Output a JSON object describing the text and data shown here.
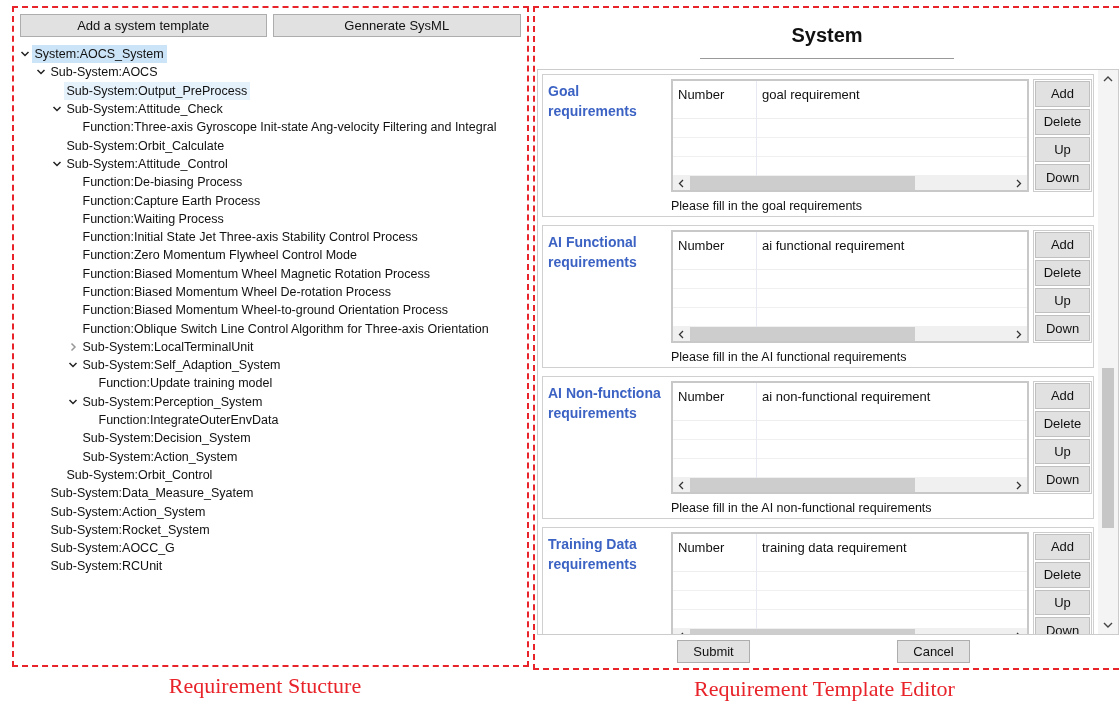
{
  "structure_panel": {
    "buttons": [
      "Add a system template",
      "Gennerate SysML"
    ],
    "tree": [
      {
        "label": "System:AOCS_System",
        "selected": true,
        "expanded": true,
        "children": [
          {
            "label": "Sub-System:AOCS",
            "selected": false,
            "expanded": true,
            "children": [
              {
                "label": "Sub-System:Output_PreProcess",
                "selected": true
              },
              {
                "label": "Sub-System:Attitude_Check",
                "selected": false,
                "expanded": true,
                "children": [
                  {
                    "label": "Function:Three-axis Gyroscope Init-state Ang-velocity Filtering and Integral",
                    "selected": false
                  }
                ]
              },
              {
                "label": "Sub-System:Orbit_Calculate",
                "selected": false
              },
              {
                "label": "Sub-System:Attitude_Control",
                "selected": false,
                "expanded": true,
                "children": [
                  {
                    "label": "Function:De-biasing Process",
                    "selected": false
                  },
                  {
                    "label": "Function:Capture Earth Process",
                    "selected": false
                  },
                  {
                    "label": "Function:Waiting Process",
                    "selected": false
                  },
                  {
                    "label": "Function:Initial State Jet Three-axis Stability Control Process",
                    "selected": false
                  },
                  {
                    "label": "Function:Zero Momentum Flywheel Control Mode",
                    "selected": false
                  },
                  {
                    "label": "Function:Biased Momentum Wheel Magnetic Rotation Process",
                    "selected": false
                  },
                  {
                    "label": "Function:Biased Momentum Wheel De-rotation Process",
                    "selected": false
                  },
                  {
                    "label": "Function:Biased Momentum Wheel-to-ground Orientation Process",
                    "selected": false
                  },
                  {
                    "label": "Function:Oblique Switch Line Control Algorithm for Three-axis Orientation",
                    "selected": false
                  },
                  {
                    "label": "Sub-System:LocalTerminalUnit",
                    "selected": false,
                    "expanded": false
                  },
                  {
                    "label": "Sub-System:Self_Adaption_System",
                    "selected": false,
                    "expanded": true,
                    "children": [
                      {
                        "label": "Function:Update training model",
                        "selected": false
                      }
                    ]
                  },
                  {
                    "label": "Sub-System:Perception_System",
                    "selected": false,
                    "expanded": true,
                    "children": [
                      {
                        "label": "Function:IntegrateOuterEnvData",
                        "selected": false
                      }
                    ]
                  },
                  {
                    "label": "Sub-System:Decision_System",
                    "selected": false
                  },
                  {
                    "label": "Sub-System:Action_System",
                    "selected": false
                  }
                ]
              },
              {
                "label": "Sub-System:Orbit_Control",
                "selected": false
              }
            ]
          },
          {
            "label": "Sub-System:Data_Measure_Syatem",
            "selected": false
          },
          {
            "label": "Sub-System:Action_System",
            "selected": false
          },
          {
            "label": "Sub-System:Rocket_System",
            "selected": false
          },
          {
            "label": "Sub-System:AOCC_G",
            "selected": false
          },
          {
            "label": "Sub-System:RCUnit",
            "selected": false
          }
        ]
      }
    ],
    "caption": "Requirement Stucture"
  },
  "editor_panel": {
    "title": "System",
    "sections": [
      {
        "label": "Goal requirements",
        "columns": [
          "Number",
          "goal requirement"
        ],
        "buttons": [
          "Add",
          "Delete",
          "Up",
          "Down"
        ],
        "hint": "Please fill in the goal requirements"
      },
      {
        "label": "AI Functional requirements",
        "columns": [
          "Number",
          "ai functional requirement"
        ],
        "buttons": [
          "Add",
          "Delete",
          "Up",
          "Down"
        ],
        "hint": "Please fill in the AI functional requirements"
      },
      {
        "label": "AI Non-functiona requirements",
        "columns": [
          "Number",
          "ai non-functional requirement"
        ],
        "buttons": [
          "Add",
          "Delete",
          "Up",
          "Down"
        ],
        "hint": "Please fill in the AI non-functional requirements"
      },
      {
        "label": "Training Data requirements",
        "columns": [
          "Number",
          "training data requirement"
        ],
        "buttons": [
          "Add",
          "Delete",
          "Up",
          "Down"
        ]
      }
    ],
    "buttons": [
      "Submit",
      "Cancel"
    ],
    "caption": "Requirement Template Editor"
  }
}
